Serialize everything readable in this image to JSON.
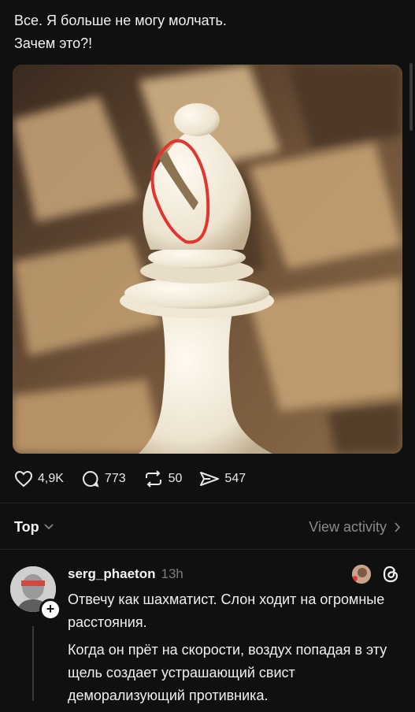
{
  "post": {
    "lines": [
      "Все. Я больше не могу молчать.",
      "Зачем это?!"
    ]
  },
  "image": {
    "subject": "chess-bishop-with-red-circle-photo"
  },
  "actions": {
    "likes": "4,9K",
    "comments": "773",
    "reposts": "50",
    "shares": "547"
  },
  "sort": {
    "label": "Top",
    "view_activity": "View activity"
  },
  "comment": {
    "username": "serg_phaeton",
    "time": "13h",
    "paragraphs": [
      "Отвечу как шахматист. Слон ходит на огромные расстояния.",
      "Когда он прёт на скорости, воздух попадая в эту щель создает устрашающий свист деморализующий противника."
    ]
  },
  "colors": {
    "background": "#101010",
    "accent_red": "#e3342f",
    "muted_text": "#8a8a8a"
  }
}
